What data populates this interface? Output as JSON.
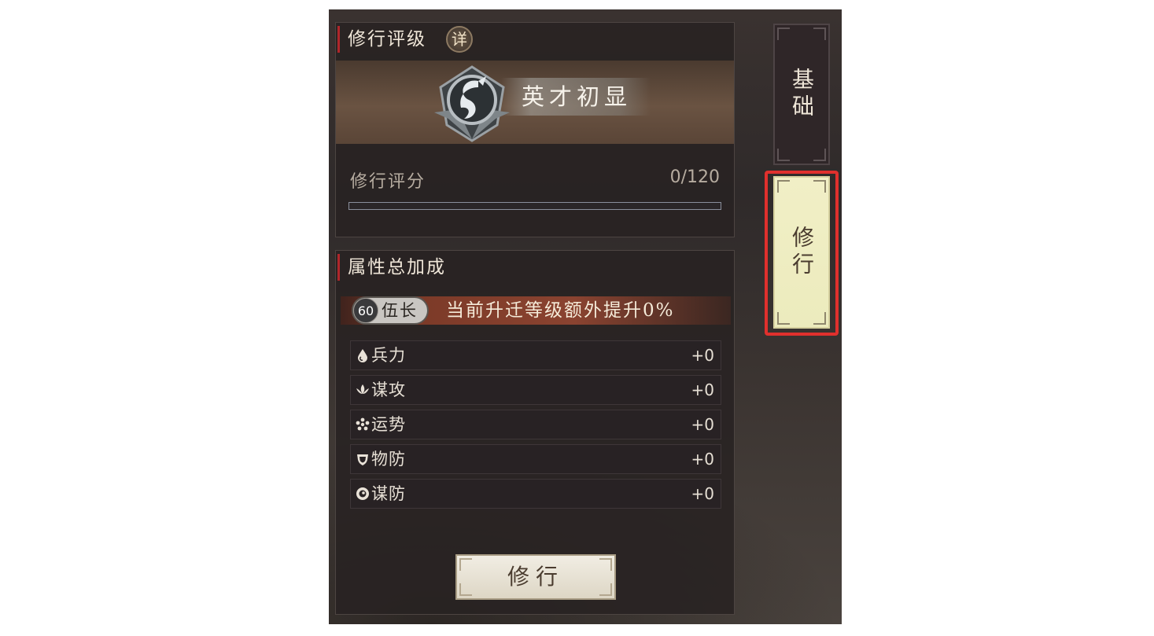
{
  "rating": {
    "title": "修行评级",
    "detail_label": "详",
    "rank_name": "英才初显",
    "score_label": "修行评分",
    "score_value": "0/120",
    "score_progress": 0
  },
  "attributes": {
    "title": "属性总加成",
    "level_number": "60",
    "level_name": "伍长",
    "bonus_text": "当前升迁等级额外提升0%",
    "stats": [
      {
        "name": "兵力",
        "value": "+0",
        "icon": "drop-icon"
      },
      {
        "name": "谋攻",
        "value": "+0",
        "icon": "lotus-icon"
      },
      {
        "name": "运势",
        "value": "+0",
        "icon": "flower-icon"
      },
      {
        "name": "物防",
        "value": "+0",
        "icon": "shield-icon"
      },
      {
        "name": "谋防",
        "value": "+0",
        "icon": "eye-icon"
      }
    ],
    "train_button": "修行"
  },
  "tabs": {
    "basic": "基础",
    "train": "修行"
  },
  "colors": {
    "highlight": "#e0302d",
    "accent_red": "#b0262a",
    "tab_active": "#f1efc6"
  }
}
